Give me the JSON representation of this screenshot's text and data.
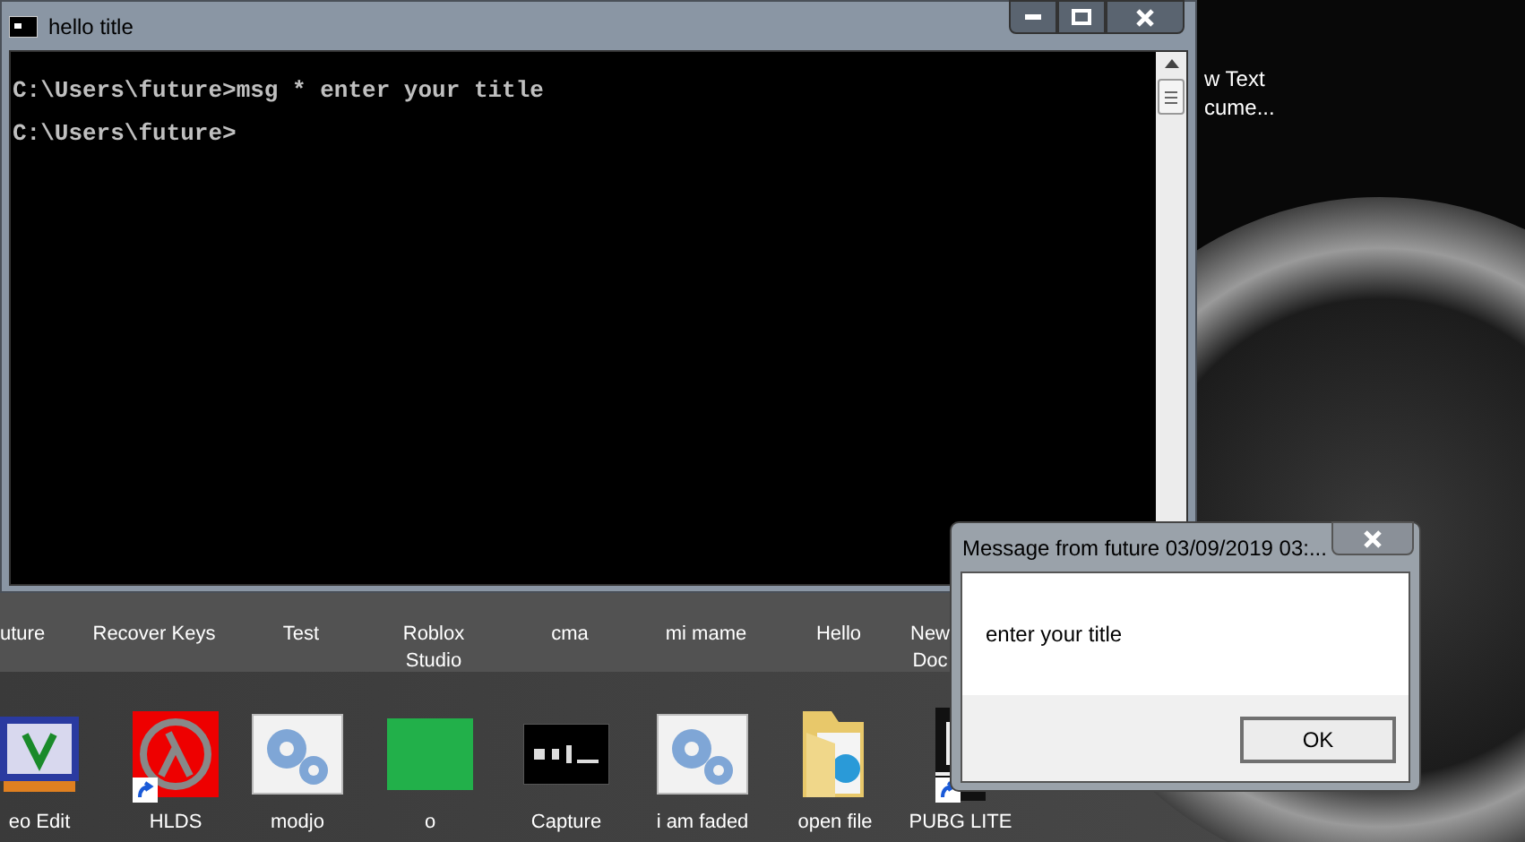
{
  "desktop": {
    "partial_label": [
      "w Text",
      "cume..."
    ],
    "icons_row_1": [
      {
        "lines": [
          "uture"
        ]
      },
      {
        "lines": [
          "Recover Keys"
        ]
      },
      {
        "lines": [
          "Test"
        ]
      },
      {
        "lines": [
          "Roblox",
          "Studio"
        ]
      },
      {
        "lines": [
          "cma"
        ]
      },
      {
        "lines": [
          "mi mame"
        ]
      },
      {
        "lines": [
          "Hello"
        ]
      },
      {
        "lines": [
          "New",
          "Doc"
        ]
      }
    ],
    "icons_row_2": [
      {
        "label": "eo Edit",
        "kind": "editor",
        "shortcut": false
      },
      {
        "label": "HLDS",
        "kind": "lambda",
        "shortcut": true
      },
      {
        "label": "modjo",
        "kind": "gears",
        "shortcut": false
      },
      {
        "label": "o",
        "kind": "green",
        "shortcut": false
      },
      {
        "label": "Capture",
        "kind": "console",
        "shortcut": false
      },
      {
        "label": "i am faded",
        "kind": "gears",
        "shortcut": false
      },
      {
        "label": "open file",
        "kind": "folder",
        "shortcut": false
      },
      {
        "label": "PUBG LITE",
        "kind": "game",
        "shortcut": true
      }
    ]
  },
  "console": {
    "title": "hello title",
    "lines": [
      "C:\\Users\\future>msg * enter your title",
      "C:\\Users\\future>"
    ]
  },
  "dialog": {
    "title": "Message from future 03/09/2019 03:...",
    "message": "enter your title",
    "button": "OK"
  }
}
